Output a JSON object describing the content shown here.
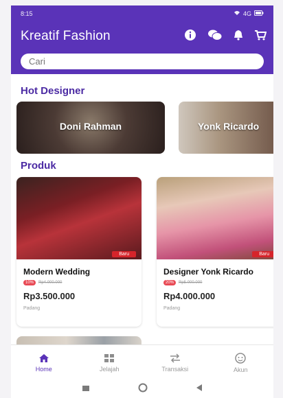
{
  "app": {
    "title": "Kreatif Fashion"
  },
  "status_bar": {
    "time": "8:15",
    "signal": "4G"
  },
  "toolbar": {
    "icons": [
      "info-icon",
      "chat-icon",
      "bell-icon",
      "cart-icon"
    ]
  },
  "search": {
    "placeholder": "Cari"
  },
  "designers": {
    "title": "Hot Designer",
    "items": [
      {
        "name": "Doni Rahman"
      },
      {
        "name": "Yonk Ricardo"
      }
    ]
  },
  "products": {
    "title": "Produk",
    "items": [
      {
        "name": "Modern Wedding",
        "badge": "Baru",
        "discount": "10%",
        "old_price": "Rp4.000.000",
        "price": "Rp3.500.000",
        "location": "Padang"
      },
      {
        "name": "Designer Yonk Ricardo",
        "badge": "Baru",
        "discount": "20%",
        "old_price": "Rp5.000.000",
        "price": "Rp4.000.000",
        "location": "Padang"
      }
    ]
  },
  "bottom_nav": {
    "items": [
      {
        "label": "Home",
        "icon": "home-icon",
        "active": true
      },
      {
        "label": "Jelajah",
        "icon": "grid-icon",
        "active": false
      },
      {
        "label": "Transaksi",
        "icon": "transfer-icon",
        "active": false
      },
      {
        "label": "Akun",
        "icon": "account-icon",
        "active": false
      }
    ]
  },
  "colors": {
    "primary": "#5a33b8",
    "accent": "#4b2aa3",
    "badge": "#d6242b",
    "discount": "#e84a55"
  }
}
